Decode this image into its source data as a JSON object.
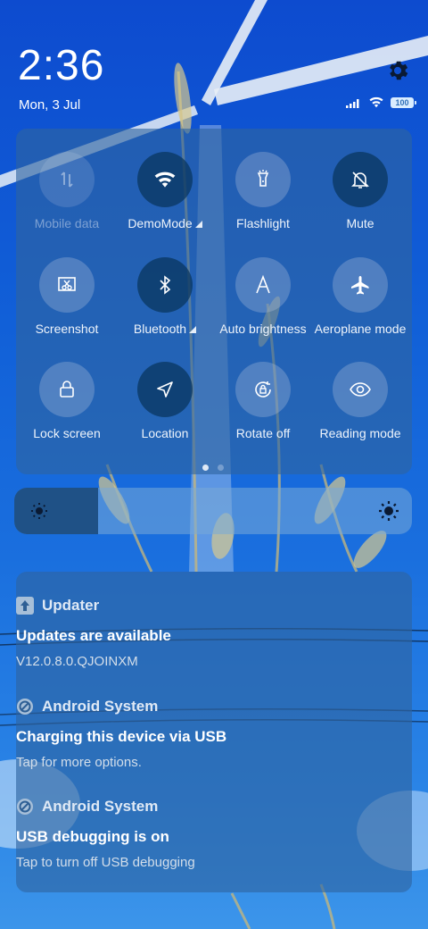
{
  "status": {
    "time": "2:36",
    "date": "Mon, 3 Jul",
    "battery": "100"
  },
  "quick_settings": {
    "tiles": [
      {
        "label": "Mobile data",
        "icon": "mobile-data-icon",
        "state": "disabled"
      },
      {
        "label": "DemoMode",
        "icon": "wifi-icon",
        "state": "on"
      },
      {
        "label": "Flashlight",
        "icon": "flashlight-icon",
        "state": "off"
      },
      {
        "label": "Mute",
        "icon": "bell-off-icon",
        "state": "on"
      },
      {
        "label": "Screenshot",
        "icon": "screenshot-icon",
        "state": "off"
      },
      {
        "label": "Bluetooth",
        "icon": "bluetooth-icon",
        "state": "on"
      },
      {
        "label": "Auto brightness",
        "icon": "auto-brightness-icon",
        "state": "off"
      },
      {
        "label": "Aeroplane mode",
        "icon": "airplane-icon",
        "state": "off"
      },
      {
        "label": "Lock screen",
        "icon": "lock-icon",
        "state": "off"
      },
      {
        "label": "Location",
        "icon": "location-arrow-icon",
        "state": "on"
      },
      {
        "label": "Rotate off",
        "icon": "rotate-lock-icon",
        "state": "off"
      },
      {
        "label": "Reading mode",
        "icon": "eye-icon",
        "state": "off"
      }
    ],
    "page_count": 2,
    "current_page": 1
  },
  "brightness": {
    "level": 0.21
  },
  "notifications": [
    {
      "app": "Updater",
      "app_icon": "update-arrow-icon",
      "title": "Updates are available",
      "text": "V12.0.8.0.QJOINXM"
    },
    {
      "app": "Android System",
      "app_icon": "android-system-icon",
      "title": "Charging this device via USB",
      "text": "Tap for more options."
    },
    {
      "app": "Android System",
      "app_icon": "android-system-icon",
      "title": "USB debugging is on",
      "text": "Tap to turn off USB debugging"
    }
  ],
  "colors": {
    "wallpaper_sky": "#1160d8",
    "panel": "#2e64a0",
    "tile_active": "#0a375f"
  }
}
